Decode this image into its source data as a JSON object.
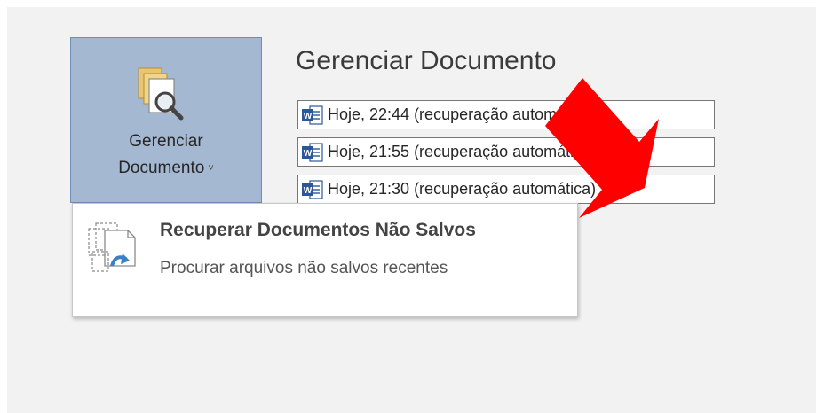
{
  "manage": {
    "label_line1": "Gerenciar",
    "label_line2": "Documento",
    "chevron": "˅",
    "icon": "manage-document-icon"
  },
  "section": {
    "title": "Gerenciar Documento"
  },
  "versions": [
    {
      "label": "Hoje, 22:44 (recuperação automática)",
      "icon": "word-doc-icon"
    },
    {
      "label": "Hoje, 21:55 (recuperação automática)",
      "icon": "word-doc-icon"
    },
    {
      "label": "Hoje, 21:30 (recuperação automática)",
      "icon": "word-doc-icon"
    }
  ],
  "menu": {
    "title": "Recuperar Documentos Não Salvos",
    "description": "Procurar arquivos não salvos recentes",
    "icon": "recover-unsaved-icon"
  },
  "annotation": {
    "color": "#ff0000",
    "icon": "red-arrow"
  },
  "colors": {
    "button_bg": "#a5b8d2",
    "word_blue": "#2b579a"
  }
}
